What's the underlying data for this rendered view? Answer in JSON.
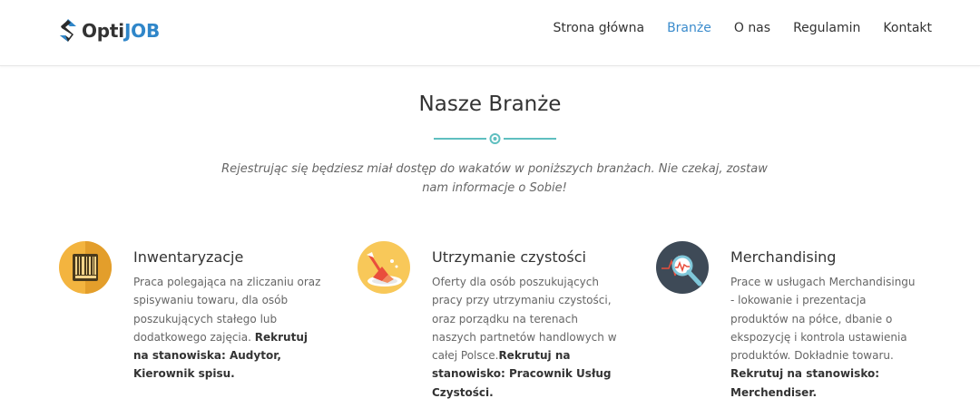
{
  "brand": {
    "part1": "Opti",
    "part2": "JOB",
    "accent": "#2f86c9"
  },
  "nav": [
    {
      "label": "Strona główna",
      "active": false
    },
    {
      "label": "Branże",
      "active": true
    },
    {
      "label": "O nas",
      "active": false
    },
    {
      "label": "Regulamin",
      "active": false
    },
    {
      "label": "Kontakt",
      "active": false
    }
  ],
  "section": {
    "title": "Nasze Branże",
    "subtitle": "Rejestrując się będziesz miał dostęp do wakatów w poniższych branżach. Nie czekaj, zostaw nam informacje o Sobie!",
    "divider_color": "#5fbfc0"
  },
  "features": [
    {
      "icon": "barcode-icon",
      "title": "Inwentaryzacje",
      "text": "Praca polegająca na zliczaniu oraz spisywaniu towaru, dla osób poszukujących stałego lub dodatkowego zajęcia. ",
      "bold": "Rekrutuj na stanowiska: Audytor, Kierownik spisu."
    },
    {
      "icon": "cleaning-icon",
      "title": "Utrzymanie czystości",
      "text": "Oferty dla osób poszukujących pracy przy utrzymaniu czystości, oraz porządku na terenach naszych partnetów handlowych w całej Polsce.",
      "bold": "Rekrutuj na stanowisko: Pracownik Usług Czystości."
    },
    {
      "icon": "magnifier-chart-icon",
      "title": "Merchandising",
      "text": "Prace w usługach Merchandisingu - lokowanie i prezentacja produktów na półce, dbanie o ekspozycję i kontrola ustawienia produktów. Dokładnie towaru. ",
      "bold": "Rekrutuj na stanowisko: Merchendiser."
    }
  ]
}
